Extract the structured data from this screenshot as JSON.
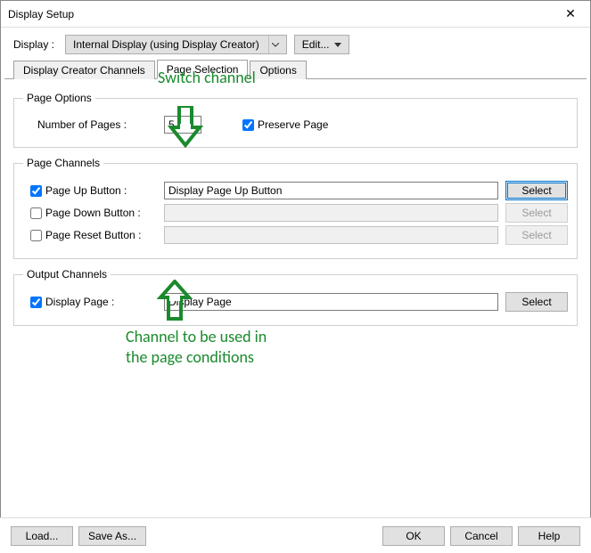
{
  "window": {
    "title": "Display Setup"
  },
  "toprow": {
    "display_label": "Display :",
    "display_value": "Internal Display (using Display Creator)",
    "edit_label": "Edit..."
  },
  "tabs": {
    "t0": "Display Creator Channels",
    "t1": "Page Selection",
    "t2": "Options"
  },
  "page_options": {
    "legend": "Page Options",
    "num_pages_label": "Number of Pages :",
    "num_pages_value": "5",
    "preserve_label": "Preserve Page"
  },
  "page_channels": {
    "legend": "Page Channels",
    "page_up_label": "Page Up Button :",
    "page_up_value": "Display Page Up Button",
    "page_down_label": "Page Down Button :",
    "page_down_value": "",
    "page_reset_label": "Page Reset Button :",
    "page_reset_value": "",
    "select_label": "Select"
  },
  "output_channels": {
    "legend": "Output Channels",
    "display_page_label": "Display Page :",
    "display_page_value": "Display Page",
    "select_label": "Select"
  },
  "annotations": {
    "switch": "Switch channel",
    "used": "Channel to be used in\nthe page conditions"
  },
  "buttons": {
    "load": "Load...",
    "saveas": "Save As...",
    "ok": "OK",
    "cancel": "Cancel",
    "help": "Help"
  }
}
